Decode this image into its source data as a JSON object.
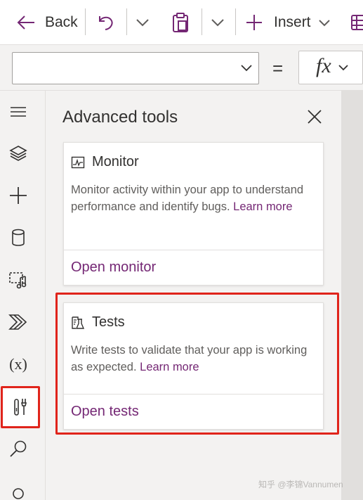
{
  "toolbar": {
    "back_label": "Back",
    "insert_label": "Insert"
  },
  "formula_bar": {
    "property_value": "",
    "equals": "=",
    "fx_label": "fx"
  },
  "rail": {
    "items": [
      {
        "name": "tree-view",
        "icon": "hamburger-icon"
      },
      {
        "name": "layers",
        "icon": "layers-icon"
      },
      {
        "name": "insert",
        "icon": "plus-icon"
      },
      {
        "name": "data",
        "icon": "database-icon"
      },
      {
        "name": "media",
        "icon": "media-icon"
      },
      {
        "name": "power-automate",
        "icon": "power-automate-icon"
      },
      {
        "name": "variables",
        "icon": "variables-icon",
        "text": "(x)"
      },
      {
        "name": "advanced-tools",
        "icon": "tools-icon",
        "active": true
      },
      {
        "name": "search",
        "icon": "search-icon"
      }
    ]
  },
  "panel": {
    "title": "Advanced tools",
    "cards": [
      {
        "title": "Monitor",
        "description": "Monitor activity within your app to understand performance and identify bugs.",
        "learn_more": "Learn more",
        "action": "Open monitor"
      },
      {
        "title": "Tests",
        "description": "Write tests to validate that your app is working as expected.",
        "learn_more": "Learn more",
        "action": "Open tests"
      }
    ]
  },
  "colors": {
    "accent": "#742774",
    "highlight": "#e0241b",
    "panel_bg": "#f3f2f1"
  },
  "watermark": "知乎 @李锦Vannumen"
}
